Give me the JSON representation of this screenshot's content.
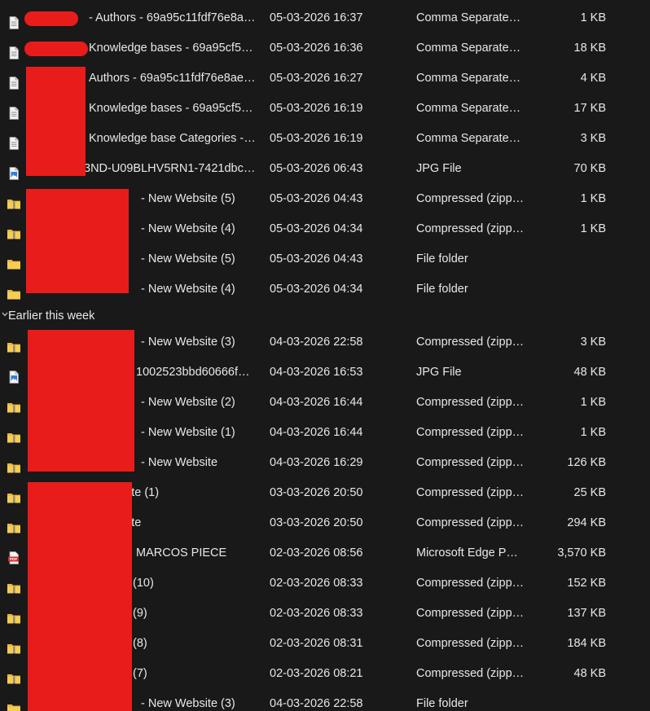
{
  "group": {
    "label": "Earlier this week"
  },
  "rows_top": [
    {
      "icon": "csv-file-icon",
      "name": "- Authors - 69a95c11fdf76e8ae…",
      "date": "05-03-2026 16:37",
      "type": "Comma Separated…",
      "size": "1 KB"
    },
    {
      "icon": "csv-file-icon",
      "name": "Knowledge bases - 69a95cf5…",
      "date": "05-03-2026 16:36",
      "type": "Comma Separated…",
      "size": "18 KB"
    },
    {
      "icon": "csv-file-icon",
      "name": "Authors - 69a95c11fdf76e8ae…",
      "date": "05-03-2026 16:27",
      "type": "Comma Separated…",
      "size": "4 KB"
    },
    {
      "icon": "csv-file-icon",
      "name": "Knowledge bases - 69a95cf5…",
      "date": "05-03-2026 16:19",
      "type": "Comma Separated…",
      "size": "17 KB"
    },
    {
      "icon": "csv-file-icon",
      "name": "Knowledge base Categories -…",
      "date": "05-03-2026 16:19",
      "type": "Comma Separated…",
      "size": "3 KB"
    },
    {
      "icon": "jpg-file-icon",
      "name": "3ND-U09BLHV5RN1-7421dbc8…",
      "date": "05-03-2026 06:43",
      "type": "JPG File",
      "size": "70 KB"
    },
    {
      "icon": "zip-folder-icon",
      "name": "- New Website (5)",
      "date": "05-03-2026 04:43",
      "type": "Compressed (zipp…",
      "size": "1 KB"
    },
    {
      "icon": "zip-folder-icon",
      "name": "- New Website (4)",
      "date": "05-03-2026 04:34",
      "type": "Compressed (zipp…",
      "size": "1 KB"
    },
    {
      "icon": "folder-icon",
      "name": "- New Website (5)",
      "date": "05-03-2026 04:43",
      "type": "File folder",
      "size": ""
    },
    {
      "icon": "folder-icon",
      "name": "- New Website (4)",
      "date": "05-03-2026 04:34",
      "type": "File folder",
      "size": ""
    }
  ],
  "rows_week": [
    {
      "icon": "zip-folder-icon",
      "name": "- New Website (3)",
      "date": "04-03-2026 22:58",
      "type": "Compressed (zipp…",
      "size": "3 KB"
    },
    {
      "icon": "jpg-file-icon",
      "name": "1002523bbd60666fb…",
      "date": "04-03-2026 16:53",
      "type": "JPG File",
      "size": "48 KB"
    },
    {
      "icon": "zip-folder-icon",
      "name": "- New Website (2)",
      "date": "04-03-2026 16:44",
      "type": "Compressed (zipp…",
      "size": "1 KB"
    },
    {
      "icon": "zip-folder-icon",
      "name": "- New Website (1)",
      "date": "04-03-2026 16:44",
      "type": "Compressed (zipp…",
      "size": "1 KB"
    },
    {
      "icon": "zip-folder-icon",
      "name": "- New Website",
      "date": "04-03-2026 16:29",
      "type": "Compressed (zipp…",
      "size": "126 KB"
    },
    {
      "icon": "zip-folder-icon",
      "name": "ite (1)",
      "date": "03-03-2026 20:50",
      "type": "Compressed (zipp…",
      "size": "25 KB"
    },
    {
      "icon": "zip-folder-icon",
      "name": "ite",
      "date": "03-03-2026 20:50",
      "type": "Compressed (zipp…",
      "size": "294 KB"
    },
    {
      "icon": "pdf-file-icon",
      "name": "MARCOS PIECE",
      "date": "02-03-2026 08:56",
      "type": "Microsoft Edge PD…",
      "size": "3,570 KB"
    },
    {
      "icon": "zip-folder-icon",
      "name": "(10)",
      "date": "02-03-2026 08:33",
      "type": "Compressed (zipp…",
      "size": "152 KB"
    },
    {
      "icon": "zip-folder-icon",
      "name": "(9)",
      "date": "02-03-2026 08:33",
      "type": "Compressed (zipp…",
      "size": "137 KB"
    },
    {
      "icon": "zip-folder-icon",
      "name": "(8)",
      "date": "02-03-2026 08:31",
      "type": "Compressed (zipp…",
      "size": "184 KB"
    },
    {
      "icon": "zip-folder-icon",
      "name": "(7)",
      "date": "02-03-2026 08:21",
      "type": "Compressed (zipp…",
      "size": "48 KB"
    },
    {
      "icon": "folder-icon",
      "name": "- New Website (3)",
      "date": "04-03-2026 22:58",
      "type": "File folder",
      "size": ""
    }
  ],
  "colors": {
    "background": "#191919",
    "text": "#e8e8e8",
    "folder": "#f4c542",
    "redaction": "#e91c1c"
  }
}
